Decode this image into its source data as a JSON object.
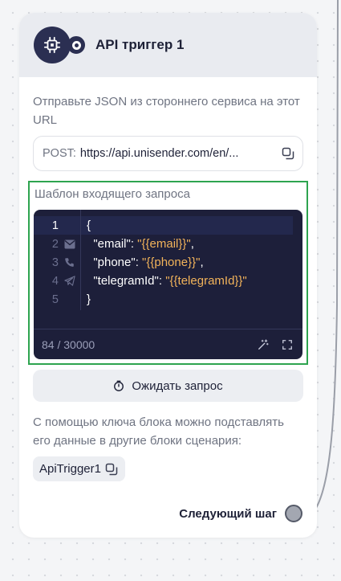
{
  "node": {
    "title": "API триггер 1",
    "description": "Отправьте JSON из стороннего сервиса на этот URL",
    "url_method": "POST:",
    "url_value": "https://api.unisender.com/en/...",
    "template_label": "Шаблон входящего запроса",
    "code_lines": [
      {
        "num": "1",
        "icon": "",
        "parts": [
          {
            "t": "{",
            "c": "key"
          }
        ]
      },
      {
        "num": "2",
        "icon": "email-icon",
        "parts": [
          {
            "t": "  \"email\": ",
            "c": "key"
          },
          {
            "t": "\"{{email}}\"",
            "c": "str"
          },
          {
            "t": ",",
            "c": "key"
          }
        ]
      },
      {
        "num": "3",
        "icon": "phone-icon",
        "parts": [
          {
            "t": "  \"phone\": ",
            "c": "key"
          },
          {
            "t": "\"{{phone}}\"",
            "c": "str"
          },
          {
            "t": ",",
            "c": "key"
          }
        ]
      },
      {
        "num": "4",
        "icon": "telegram-icon",
        "parts": [
          {
            "t": "  \"telegramId\": ",
            "c": "key"
          },
          {
            "t": "\"{{telegramId}}\"",
            "c": "str"
          }
        ]
      },
      {
        "num": "5",
        "icon": "",
        "parts": [
          {
            "t": "}",
            "c": "key"
          }
        ]
      }
    ],
    "char_count": "84 / 30000",
    "wait_button_label": "Ожидать запрос",
    "key_description": "С помощью ключа блока можно подставлять его данные в другие блоки сценария:",
    "block_key": "ApiTrigger1",
    "next_step_label": "Следующий шаг"
  },
  "colors": {
    "editor_bg": "#1d1f3a",
    "string_token": "#f2b35a",
    "highlight_border": "#2ea44f",
    "header_bg": "#e9ebf0",
    "badge_bg": "#2b2f52"
  }
}
